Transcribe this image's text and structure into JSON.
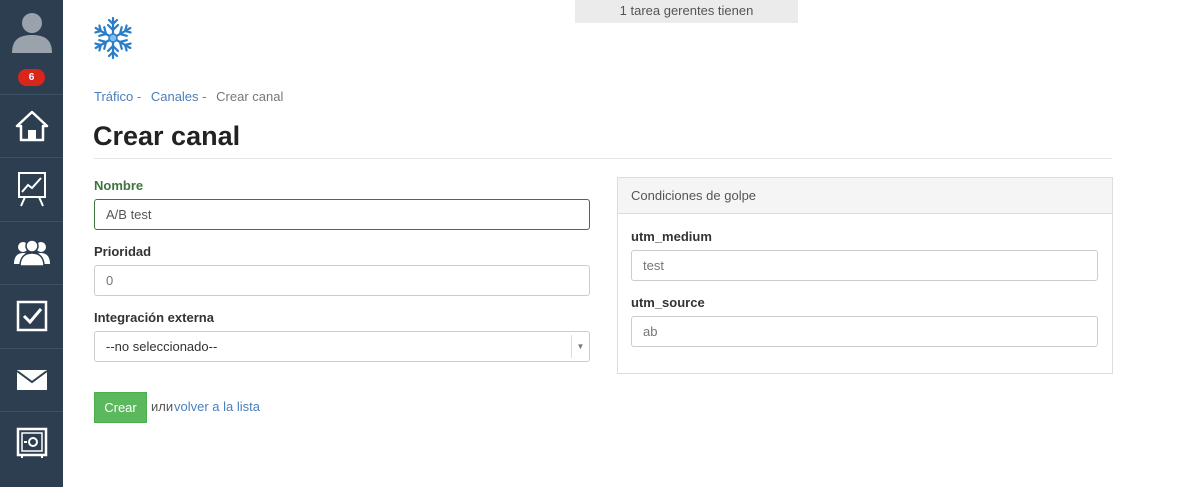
{
  "sidebar": {
    "badge_count": "6",
    "items": [
      {
        "icon": "home-icon"
      },
      {
        "icon": "chart-icon"
      },
      {
        "icon": "users-icon"
      },
      {
        "icon": "checkbox-icon"
      },
      {
        "icon": "mail-icon"
      },
      {
        "icon": "safe-icon"
      }
    ]
  },
  "notice": "1 tarea gerentes tienen",
  "breadcrumb": {
    "trafico": "Tráfico",
    "canales": "Canales",
    "current": "Crear canal",
    "separator": "-"
  },
  "page_title": "Crear canal",
  "form": {
    "nombre_label": "Nombre",
    "nombre_value": "A/B test",
    "prioridad_label": "Prioridad",
    "prioridad_placeholder": "0",
    "integracion_label": "Integración externa",
    "integracion_selected": "--no seleccionado--"
  },
  "panel": {
    "title": "Condiciones de golpe",
    "utm_medium_label": "utm_medium",
    "utm_medium_placeholder": "test",
    "utm_source_label": "utm_source",
    "utm_source_placeholder": "ab"
  },
  "actions": {
    "create_label": "Crear",
    "or_text": "или",
    "back_link": "volver a la lista"
  },
  "colors": {
    "sidebar_bg": "#2d3e50",
    "badge": "#d9261c",
    "link": "#4a7fbd",
    "success_green": "#5cb85c",
    "label_green": "#3c763d"
  }
}
